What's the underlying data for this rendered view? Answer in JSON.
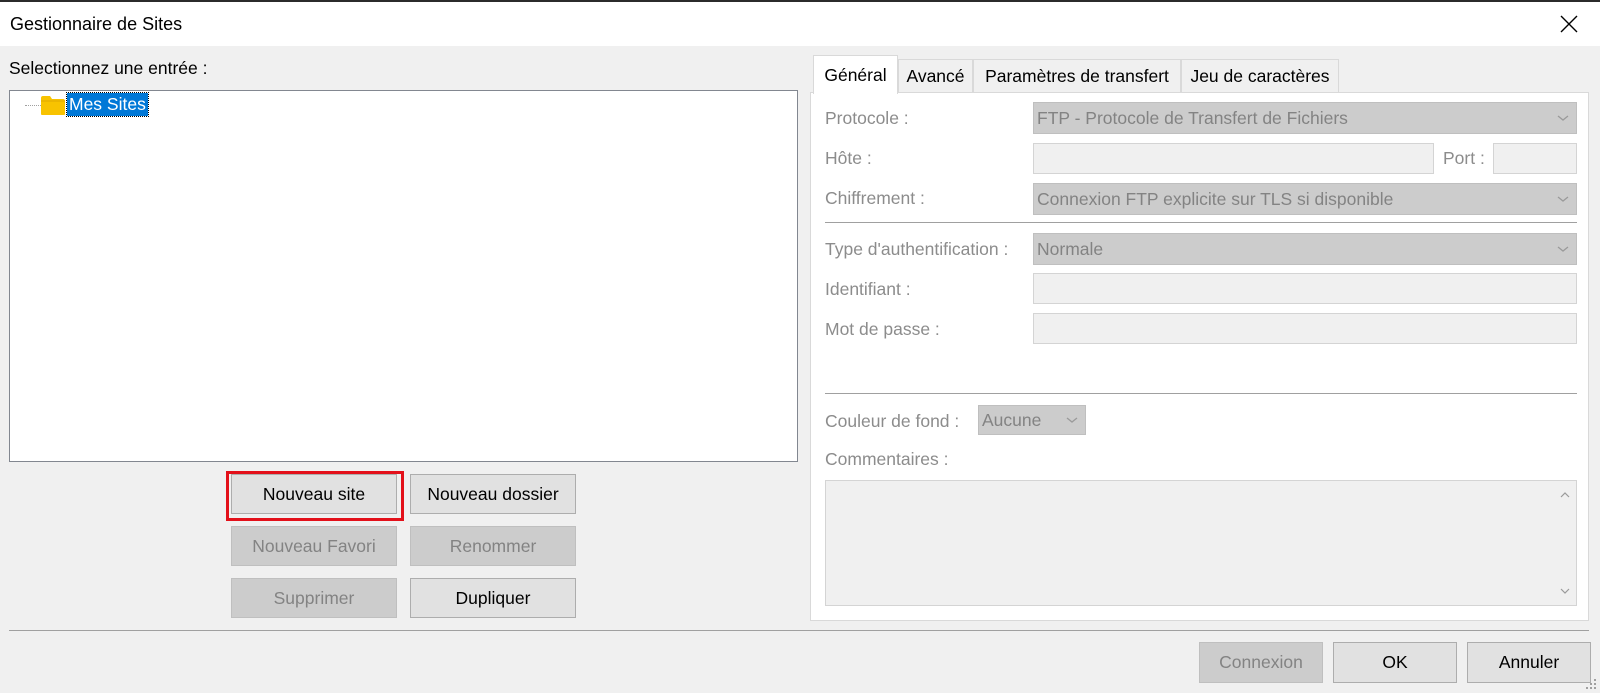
{
  "window": {
    "title": "Gestionnaire de Sites"
  },
  "left": {
    "select_label": "Selectionnez une entrée :",
    "tree": {
      "root_label": "Mes Sites"
    },
    "buttons": {
      "new_site": "Nouveau site",
      "new_folder": "Nouveau dossier",
      "new_bookmark": "Nouveau Favori",
      "rename": "Renommer",
      "delete": "Supprimer",
      "duplicate": "Dupliquer"
    }
  },
  "tabs": [
    "Général",
    "Avancé",
    "Paramètres de transfert",
    "Jeu de caractères"
  ],
  "general": {
    "protocol_label": "Protocole :",
    "protocol_value": "FTP - Protocole de Transfert de Fichiers",
    "host_label": "Hôte :",
    "host_value": "",
    "port_label": "Port :",
    "port_value": "",
    "encryption_label": "Chiffrement :",
    "encryption_value": "Connexion FTP explicite sur TLS si disponible",
    "auth_label": "Type d'authentification :",
    "auth_value": "Normale",
    "user_label": "Identifiant :",
    "user_value": "",
    "password_label": "Mot de passe :",
    "password_value": "",
    "bgcolor_label": "Couleur de fond :",
    "bgcolor_value": "Aucune",
    "comments_label": "Commentaires :"
  },
  "footer": {
    "connect": "Connexion",
    "ok": "OK",
    "cancel": "Annuler"
  },
  "colors": {
    "selection": "#0078d7",
    "highlight_border": "#e3101a",
    "folder": "#f8c300"
  },
  "icons": {
    "close": "close-icon",
    "folder": "folder-icon",
    "dropdown": "chevron-down-icon"
  }
}
